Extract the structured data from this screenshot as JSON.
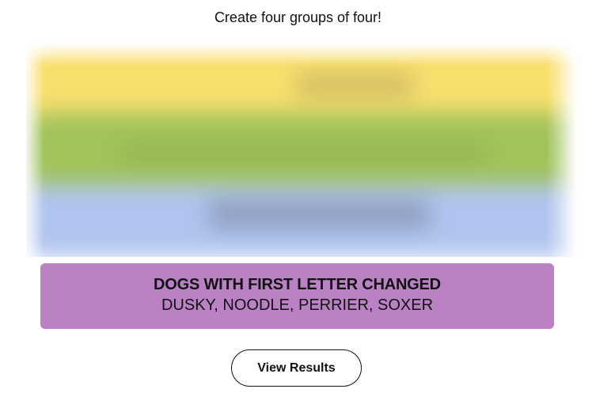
{
  "instructions": "Create four groups of four!",
  "colors": {
    "yellow": "#f9df6d",
    "green": "#a0c35a",
    "blue": "#b0c4ef",
    "purple": "#ba81c5",
    "tile": "#efefe6",
    "text": "#121212"
  },
  "solved_group": {
    "title": "DOGS WITH FIRST LETTER CHANGED",
    "members": "DUSKY, NOODLE, PERRIER, SOXER"
  },
  "view_results_label": "View Results"
}
